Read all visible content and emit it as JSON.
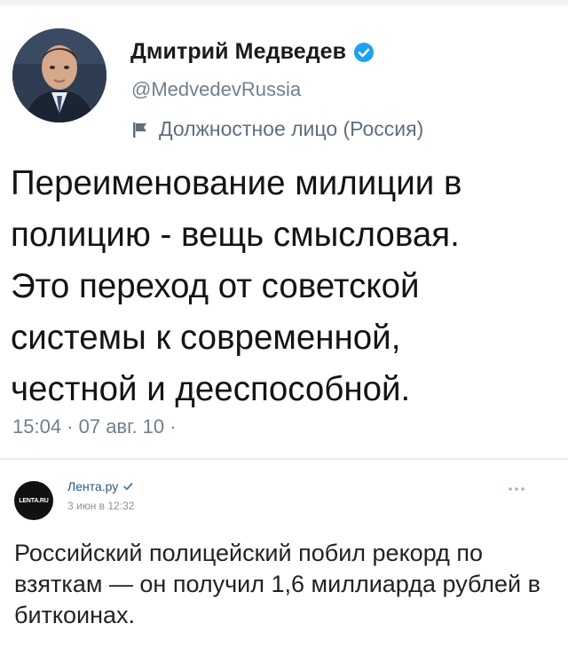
{
  "tweet": {
    "author_name": "Дмитрий Медведев",
    "handle": "@MedvedevRussia",
    "account_label": "Должностное лицо (Россия)",
    "text": "Переименование милиции в\nполицию - вещь смысловая.\nЭто переход от советской\nсистемы к современной,\nчестной и дееспособной.",
    "timestamp": "15:04 · 07 авг. 10 ·",
    "verified_color": "#1da1f2",
    "icons": [
      "verified-badge-icon",
      "government-flag-icon"
    ]
  },
  "vk_post": {
    "avatar_text": "LENTA.RU",
    "author_name": "Лента.ру",
    "date": "3 июн в 12:32",
    "text": "Российский полицейский побил рекорд по взяткам — он получил 1,6 миллиарда рублей в биткоинах.",
    "link_color": "#2a5885",
    "icons": [
      "verified-check-icon",
      "more-options-icon"
    ]
  }
}
